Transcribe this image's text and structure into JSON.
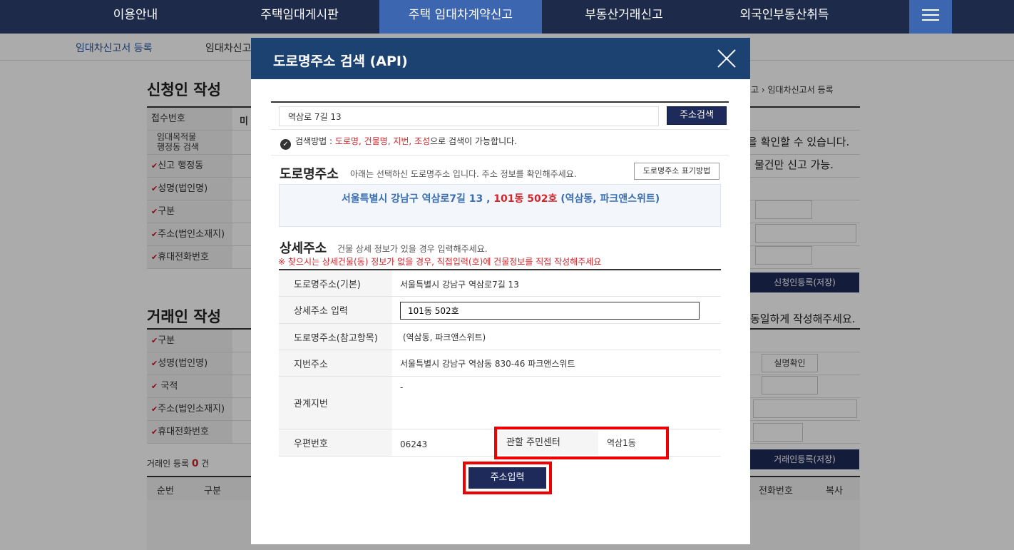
{
  "topnav": {
    "items": [
      "이용안내",
      "주택임대게시판",
      "주택 임대차계약신고",
      "부동산거래신고",
      "외국인부동산취득"
    ]
  },
  "subnav": {
    "items": [
      "임대차신고서 등록",
      "임대차신고"
    ]
  },
  "background": {
    "section1_title": "신청인 작성",
    "breadcrumb_tail": "신고 ›  임대차신고서 등록",
    "rows1": [
      "접수번호",
      "임대목적물\n행정동 검색",
      "신고 행정동",
      "성명(법인명)",
      "구분",
      "주소(법인소재지)",
      "휴대전화번호"
    ],
    "row1_value": "미",
    "right_text1": "을 확인할 수 있습니다.",
    "right_text2": "물건만 신고 가능.",
    "applicant_save": "신청인등록(저장)",
    "section2_title": "거래인 작성",
    "right_text3": "동일하게 작성해주세요.",
    "rows2": [
      "구분",
      "성명(법인명)",
      "국적",
      "주소(법인소재지)",
      "휴대전화번호"
    ],
    "verify_button": "실명확인",
    "count_prefix": "거래인 등록",
    "count_value": "0",
    "count_suffix": "건",
    "trader_save": "거래인등록(저장)",
    "table_headers": [
      "순번",
      "구분",
      "전화번호",
      "복사"
    ]
  },
  "modal": {
    "title": "도로명주소 검색 (API)",
    "search_value": "역삼로 7길 13",
    "search_button": "주소검색",
    "hint_prefix": "검색방법 : ",
    "hint_terms": "도로명, 건물명, 지번, 조성",
    "hint_suffix": "으로 검색이 가능합니다.",
    "road_title": "도로명주소",
    "road_desc": "아래는 선택하신 도로명주소 입니다. 주소 정보를 확인해주세요.",
    "road_format_button": "도로명주소 표기방법",
    "road_addr_main": "서울특별시 강남구 역삼로7길 13 , ",
    "road_addr_detail": "101동 502호",
    "road_addr_ref": "  (역삼동, 파크앤스위트)",
    "detail_title": "상세주소",
    "detail_desc": "건물 상세 정보가 있을 경우 입력해주세요.",
    "detail_warning": "※ 찾으시는 상세건물(동) 정보가 없을 경우, 직접입력(호)에 건물정보를 직접 작성해주세요",
    "rows": {
      "road_basic_label": "도로명주소(기본)",
      "road_basic_value": "서울특별시 강남구 역삼로7길 13",
      "detail_input_label": "상세주소 입력",
      "detail_input_value": "101동 502호",
      "road_ref_label": "도로명주소(참고항목)",
      "road_ref_value": " (역삼동, 파크앤스위트)",
      "jibun_label": "지번주소",
      "jibun_value": "서울특별시 강남구 역삼동 830-46 파크앤스위트",
      "related_label": "관계지번",
      "related_value": "-",
      "zip_label": "우편번호",
      "zip_value": "06243",
      "center_label": "관할 주민센터",
      "center_value": "역삼1동"
    },
    "submit_button": "주소입력"
  }
}
